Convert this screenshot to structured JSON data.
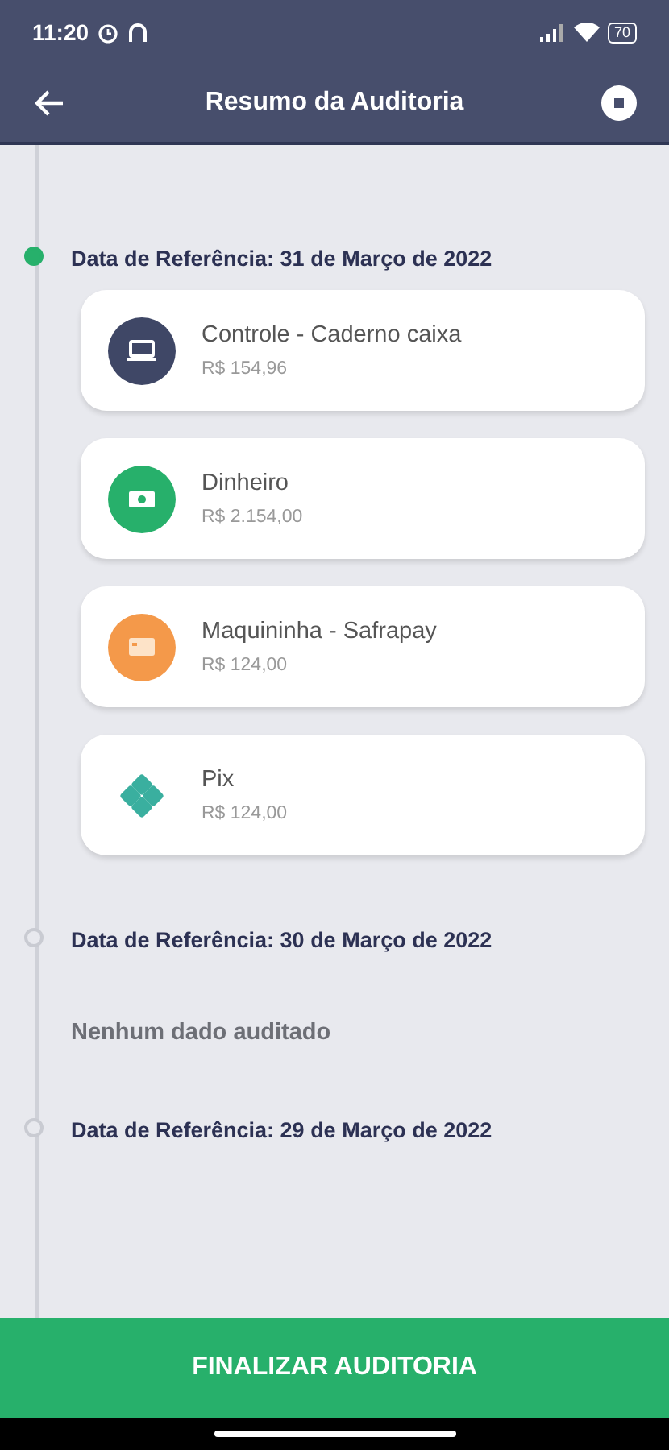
{
  "status_bar": {
    "time": "11:20",
    "battery": "70"
  },
  "app_bar": {
    "title": "Resumo da Auditoria"
  },
  "sections": [
    {
      "date": "Data de Referência: 31 de Março de 2022",
      "active": true,
      "items": [
        {
          "kind": "laptop",
          "color": "#3f4766",
          "name": "Controle - Caderno caixa",
          "amount": "R$ 154,96"
        },
        {
          "kind": "cash",
          "color": "#27b06b",
          "name": "Dinheiro",
          "amount": "R$ 2.154,00"
        },
        {
          "kind": "card",
          "color": "#f4994a",
          "name": "Maquininha - Safrapay",
          "amount": "R$ 124,00"
        },
        {
          "kind": "pix",
          "color": "#3aaf9f",
          "name": "Pix",
          "amount": "R$ 124,00"
        }
      ]
    },
    {
      "date": "Data de Referência: 30 de Março de 2022",
      "active": false,
      "empty": "Nenhum dado auditado"
    },
    {
      "date": "Data de Referência: 29 de Março de 2022",
      "active": false
    }
  ],
  "footer_button": "FINALIZAR AUDITORIA"
}
